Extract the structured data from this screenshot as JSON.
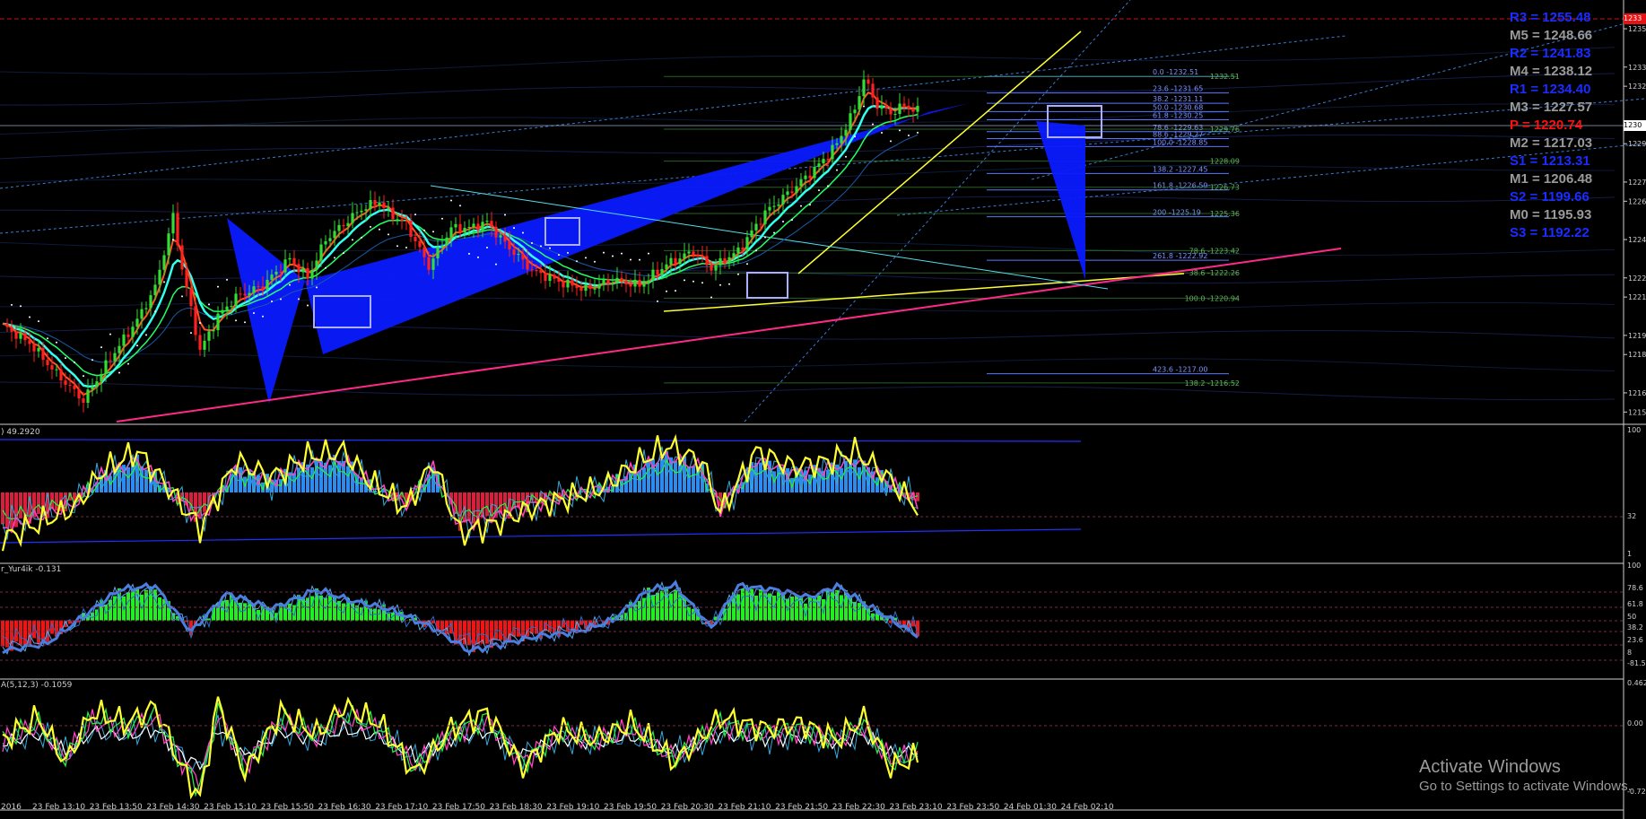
{
  "app": {
    "price_badge": "1233",
    "current_price": "1230",
    "activation_title": "Activate Windows",
    "activation_subtitle": "Go to Settings to activate Windows."
  },
  "colors": {
    "bull": "#33dd33",
    "bear": "#ff2020",
    "ma_fast": "#ff5522",
    "ma_cyan": "#33ffee",
    "ma_green": "#22ff66",
    "wedge": "#0a1aff",
    "yellow": "#ffff30",
    "magenta": "#ff2a88",
    "fib_blue": "#5a78ff",
    "fib_green": "#3fa03f",
    "pivot_blue": "#1a2cff",
    "pivot_gray": "#9a9a9a",
    "pivot_red": "#ff1010"
  },
  "pivots": [
    {
      "label": "R3 = 1255.48",
      "color": "#1a2cff"
    },
    {
      "label": "M5 = 1248.66",
      "color": "#9a9a9a"
    },
    {
      "label": "R2 = 1241.83",
      "color": "#1a2cff"
    },
    {
      "label": "M4 = 1238.12",
      "color": "#9a9a9a"
    },
    {
      "label": "R1 = 1234.40",
      "color": "#1a2cff"
    },
    {
      "label": "M3 = 1227.57",
      "color": "#9a9a9a"
    },
    {
      "label": "P = 1220.74",
      "color": "#ff1010"
    },
    {
      "label": "M2 = 1217.03",
      "color": "#9a9a9a"
    },
    {
      "label": "S1 = 1213.31",
      "color": "#1a2cff"
    },
    {
      "label": "M1 = 1206.48",
      "color": "#9a9a9a"
    },
    {
      "label": "S2 = 1199.66",
      "color": "#1a2cff"
    },
    {
      "label": "M0 = 1195.93",
      "color": "#9a9a9a"
    },
    {
      "label": "S3 = 1192.22",
      "color": "#1a2cff"
    }
  ],
  "chart_data": [
    {
      "type": "line",
      "name": "price-panel",
      "ylim": [
        1214.5,
        1236.5
      ],
      "y_ticks": [
        1235,
        1233,
        1232,
        1230,
        1229,
        1227,
        1226,
        1224,
        1222,
        1221,
        1219,
        1218,
        1216,
        1215
      ],
      "x_ticks": [
        "2016",
        "23 Feb 13:10",
        "23 Feb 13:50",
        "23 Feb 14:30",
        "23 Feb 15:10",
        "23 Feb 15:50",
        "23 Feb 16:30",
        "23 Feb 17:10",
        "23 Feb 17:50",
        "23 Feb 18:30",
        "23 Feb 19:10",
        "23 Feb 19:50",
        "23 Feb 20:30",
        "23 Feb 21:10",
        "23 Feb 21:50",
        "23 Feb 22:30",
        "23 Feb 23:10",
        "23 Feb 23:50",
        "24 Feb 01:30",
        "24 Feb 02:10"
      ],
      "close_anchors": [
        [
          0,
          1219.5
        ],
        [
          6,
          1218.6
        ],
        [
          12,
          1217.0
        ],
        [
          18,
          1215.6
        ],
        [
          24,
          1217.8
        ],
        [
          30,
          1219.8
        ],
        [
          34,
          1221.5
        ],
        [
          38,
          1225.2
        ],
        [
          40,
          1222.5
        ],
        [
          44,
          1218.2
        ],
        [
          48,
          1220.0
        ],
        [
          52,
          1221.0
        ],
        [
          58,
          1221.6
        ],
        [
          64,
          1223.0
        ],
        [
          68,
          1222.0
        ],
        [
          72,
          1224.0
        ],
        [
          76,
          1224.8
        ],
        [
          80,
          1225.6
        ],
        [
          84,
          1226.0
        ],
        [
          86,
          1225.4
        ],
        [
          90,
          1224.8
        ],
        [
          95,
          1222.6
        ],
        [
          100,
          1224.6
        ],
        [
          104,
          1224.6
        ],
        [
          108,
          1224.9
        ],
        [
          112,
          1223.8
        ],
        [
          118,
          1222.4
        ],
        [
          124,
          1221.8
        ],
        [
          130,
          1221.4
        ],
        [
          136,
          1221.9
        ],
        [
          142,
          1221.6
        ],
        [
          148,
          1222.7
        ],
        [
          154,
          1223.4
        ],
        [
          158,
          1222.5
        ],
        [
          164,
          1223.4
        ],
        [
          170,
          1225.4
        ],
        [
          176,
          1226.6
        ],
        [
          182,
          1227.9
        ],
        [
          186,
          1229.0
        ],
        [
          190,
          1230.8
        ],
        [
          192,
          1232.4
        ],
        [
          195,
          1231.0
        ],
        [
          198,
          1230.6
        ],
        [
          201,
          1231.0
        ],
        [
          204,
          1230.7
        ]
      ],
      "fib_levels": [
        {
          "label": "0.0 -1232.51",
          "value": 1232.51
        },
        {
          "label": "23.6 -1231.65",
          "value": 1231.65
        },
        {
          "label": "38.2 -1231.11",
          "value": 1231.11
        },
        {
          "label": "50.0 -1230.68",
          "value": 1230.68
        },
        {
          "label": "61.8 -1230.25",
          "value": 1230.25
        },
        {
          "label": "78.6 -1229.63",
          "value": 1229.63
        },
        {
          "label": "88.6 -1229.27",
          "value": 1229.27
        },
        {
          "label": "100.0 -1228.85",
          "value": 1228.85
        },
        {
          "label": "138.2 -1227.45",
          "value": 1227.45
        },
        {
          "label": "161.8 -1226.59",
          "value": 1226.59
        },
        {
          "label": "200 -1225.19",
          "value": 1225.19
        },
        {
          "label": "261.8 -1222.92",
          "value": 1222.92
        },
        {
          "label": "423.6 -1217.00",
          "value": 1217.0
        }
      ],
      "fib_levels_2": [
        {
          "label": "1232.51",
          "value": 1232.51
        },
        {
          "label": "1229.76",
          "value": 1229.76
        },
        {
          "label": "1228.09",
          "value": 1228.09
        },
        {
          "label": "1226.73",
          "value": 1226.73
        },
        {
          "label": "1225.36",
          "value": 1225.36
        },
        {
          "label": "78.6 -1223.42",
          "value": 1223.42
        },
        {
          "label": "38.6 -1222.26",
          "value": 1222.26
        },
        {
          "label": "100.0 -1220.94",
          "value": 1220.94
        },
        {
          "label": "138.2 -1216.52",
          "value": 1216.52
        }
      ]
    },
    {
      "type": "bar",
      "name": "rsi-panel",
      "label": ") 49.2920",
      "ylim": [
        0,
        100
      ],
      "y_ticks": [
        "100",
        "32",
        "1"
      ],
      "osc_anchors": [
        [
          0,
          -0.9
        ],
        [
          8,
          -0.6
        ],
        [
          16,
          -0.3
        ],
        [
          22,
          0.4
        ],
        [
          30,
          0.8
        ],
        [
          36,
          0.2
        ],
        [
          44,
          -0.7
        ],
        [
          52,
          0.6
        ],
        [
          60,
          0.3
        ],
        [
          68,
          0.7
        ],
        [
          76,
          0.8
        ],
        [
          82,
          0.2
        ],
        [
          90,
          -0.3
        ],
        [
          96,
          0.6
        ],
        [
          102,
          -0.8
        ],
        [
          110,
          -0.6
        ],
        [
          118,
          -0.3
        ],
        [
          126,
          -0.1
        ],
        [
          134,
          0.1
        ],
        [
          140,
          0.5
        ],
        [
          148,
          0.9
        ],
        [
          156,
          0.6
        ],
        [
          160,
          -0.4
        ],
        [
          168,
          0.8
        ],
        [
          176,
          0.5
        ],
        [
          184,
          0.6
        ],
        [
          190,
          0.8
        ],
        [
          196,
          0.4
        ],
        [
          204,
          -0.3
        ]
      ]
    },
    {
      "type": "bar",
      "name": "stoch-panel",
      "label": "r_Yur4ik -0.131",
      "y_ticks": [
        "100",
        "78.6",
        "61.8",
        "50",
        "38.2",
        "23.6",
        "8",
        "-81.51"
      ],
      "osc_anchors": [
        [
          0,
          -0.8
        ],
        [
          10,
          -0.6
        ],
        [
          18,
          0.1
        ],
        [
          26,
          0.8
        ],
        [
          34,
          0.9
        ],
        [
          42,
          -0.3
        ],
        [
          50,
          0.7
        ],
        [
          60,
          0.3
        ],
        [
          70,
          0.8
        ],
        [
          78,
          0.5
        ],
        [
          86,
          0.3
        ],
        [
          96,
          -0.2
        ],
        [
          104,
          -0.8
        ],
        [
          112,
          -0.6
        ],
        [
          120,
          -0.4
        ],
        [
          128,
          -0.3
        ],
        [
          136,
          0.0
        ],
        [
          144,
          0.8
        ],
        [
          150,
          0.9
        ],
        [
          158,
          -0.2
        ],
        [
          164,
          0.9
        ],
        [
          172,
          0.8
        ],
        [
          180,
          0.6
        ],
        [
          186,
          0.9
        ],
        [
          194,
          0.3
        ],
        [
          204,
          -0.4
        ]
      ]
    },
    {
      "type": "line",
      "name": "macd-panel",
      "label": "A(5,12,3) -0.1059",
      "y_ticks": [
        "0.462",
        "0.00",
        "-0.72"
      ],
      "osc_anchors": [
        [
          0,
          0.1
        ],
        [
          8,
          0.5
        ],
        [
          14,
          -0.3
        ],
        [
          20,
          0.6
        ],
        [
          28,
          0.4
        ],
        [
          34,
          0.7
        ],
        [
          40,
          -0.4
        ],
        [
          44,
          -0.95
        ],
        [
          48,
          0.8
        ],
        [
          54,
          -0.5
        ],
        [
          62,
          0.6
        ],
        [
          70,
          0.2
        ],
        [
          76,
          0.7
        ],
        [
          84,
          0.4
        ],
        [
          92,
          -0.5
        ],
        [
          100,
          0.3
        ],
        [
          108,
          0.6
        ],
        [
          116,
          -0.4
        ],
        [
          124,
          0.3
        ],
        [
          132,
          0.1
        ],
        [
          140,
          0.4
        ],
        [
          150,
          -0.3
        ],
        [
          160,
          0.5
        ],
        [
          170,
          0.3
        ],
        [
          178,
          0.4
        ],
        [
          186,
          0.1
        ],
        [
          192,
          0.5
        ],
        [
          198,
          -0.4
        ],
        [
          204,
          -0.2
        ]
      ]
    }
  ]
}
